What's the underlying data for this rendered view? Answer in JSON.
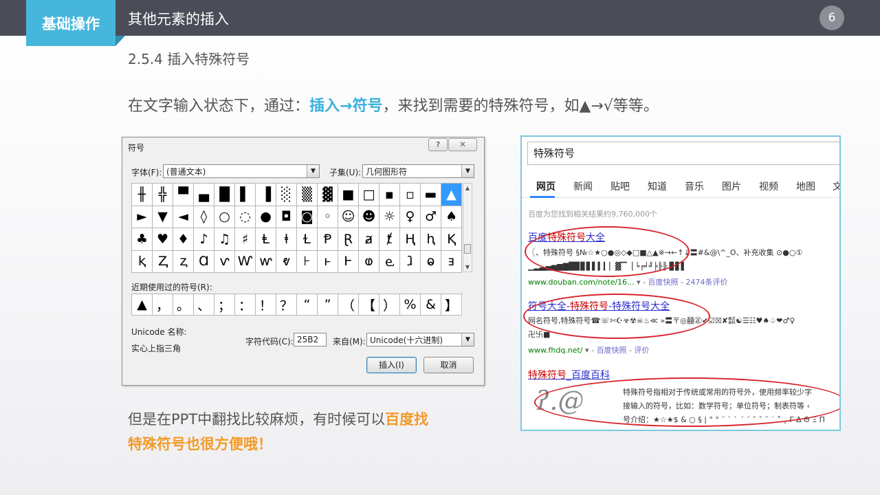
{
  "header": {
    "section_label": "基础操作",
    "slide_title": "其他元素的插入",
    "page_number": "6"
  },
  "subheading": "2.5.4 插入特殊符号",
  "intro": {
    "before": "在文字输入状态下，通过：",
    "highlight": "插入→符号",
    "after": "，来找到需要的特殊符号，如▲→√等等。"
  },
  "outro": {
    "line1_before": "但是在PPT中翻找比较麻烦，有时候可以",
    "line1_highlight": "百度找",
    "line2_highlight": "特殊符号也很方便哦！"
  },
  "dialog": {
    "title": "符号",
    "help_label": "?",
    "close_label": "✕",
    "font_label": "字体(F):",
    "font_value": "(普通文本)",
    "subset_label": "子集(U):",
    "subset_value": "几何图形符",
    "symbols": [
      "╫",
      "╬",
      "▀",
      "▄",
      "█",
      "▌",
      "▐",
      "░",
      "▒",
      "▓",
      "■",
      "□",
      "▪",
      "▫",
      "▬",
      "▲",
      "►",
      "▼",
      "◄",
      "◊",
      "○",
      "◌",
      "●",
      "◘",
      "◙",
      "◦",
      "☺",
      "☻",
      "☼",
      "♀",
      "♂",
      "♠",
      "♣",
      "♥",
      "♦",
      "♪",
      "♫",
      "♯",
      "Ⱡ",
      "ⱡ",
      "Ɫ",
      "Ᵽ",
      "Ɽ",
      "ⱥ",
      "ⱦ",
      "Ⱨ",
      "ⱨ",
      "Ⱪ",
      "ⱪ",
      "Ⱬ",
      "ⱬ",
      "Ɑ",
      "ⱱ",
      "Ⱳ",
      "ⱳ",
      "ⱴ",
      "⊦",
      "ⱶ",
      "Ⱶ",
      "ⱷ",
      "ⱸ",
      "ⱹ",
      "ⱺ",
      "ⱻ"
    ],
    "selected_symbol": "▲",
    "recent_label": "近期使用过的符号(R):",
    "recent_symbols": [
      "▲",
      "，",
      "。",
      "、",
      "；",
      "：",
      "！",
      "？",
      "“",
      "”",
      "（",
      "【",
      "）",
      "%",
      "&",
      "】"
    ],
    "unicode_name_label": "Unicode 名称:",
    "unicode_name_value": "实心上指三角",
    "char_code_label": "字符代码(C):",
    "char_code_value": "25B2",
    "from_label": "来自(M):",
    "from_value": "Unicode(十六进制)",
    "insert_button": "插入(I)",
    "cancel_button": "取消"
  },
  "baidu": {
    "search_query": "特殊符号",
    "tabs": [
      "网页",
      "新闻",
      "贴吧",
      "知道",
      "音乐",
      "图片",
      "视频",
      "地图",
      "文"
    ],
    "result_count": "百度为您找到相关结果约9,760,000个",
    "results": [
      {
        "title_parts": [
          "百度",
          "特殊符号",
          "大全"
        ],
        "snippet_lines": [
          "〖、特殊符号 §№☆★○●◎◇◆□■△▲※→←↑↓〓#&@\\^_O、补充收集 ⊙●○①",
          "▁▂▃▄▅▆▇█▉▊▋▌▍▎▏▓▔▕ ╘╒╛╝╞╟╠ ▊▋▌"
        ],
        "url": "www.douban.com/note/16...",
        "cache": "百度快照",
        "reviews": "2474条评价"
      },
      {
        "title_parts": [
          "符号大全-",
          "特殊符号",
          "-特殊符号大全"
        ],
        "snippet_lines": [
          "网名符号,特殊符号☎☏✄☪☣☢☠♨≪ »〓〒◎囍㊣✔☑☒✘㍿☯☰☷♥♠♤❤♂♀",
          "卍卐■"
        ],
        "url": "www.fhdq.net/",
        "cache": "百度快照",
        "reviews": "评价"
      },
      {
        "title_parts": [
          "特殊符号",
          "_百度百科"
        ],
        "snippet_lines": [
          "特殊符号指相对于传统或常用的符号外，使用频率较少字",
          "接输入的符号，比如：数学符号；单位符号；制表符等 ‹",
          "号介绍：★☆★$ & ○ § | ° ° ¨ ` ` ´ ´ ˆ ˇ ˘ ˙ ˚ ˛ Γ Δ Θ Ξ Π"
        ],
        "image_glyphs": "ʔ.@"
      }
    ]
  },
  "colors": {
    "header_bg": "#4a4c57",
    "accent_blue": "#47b6dc",
    "highlight_blue": "#3ab0dc",
    "highlight_orange": "#f39a26",
    "annotation_red": "#d8242b",
    "baidu_link": "#2a2fc9"
  }
}
